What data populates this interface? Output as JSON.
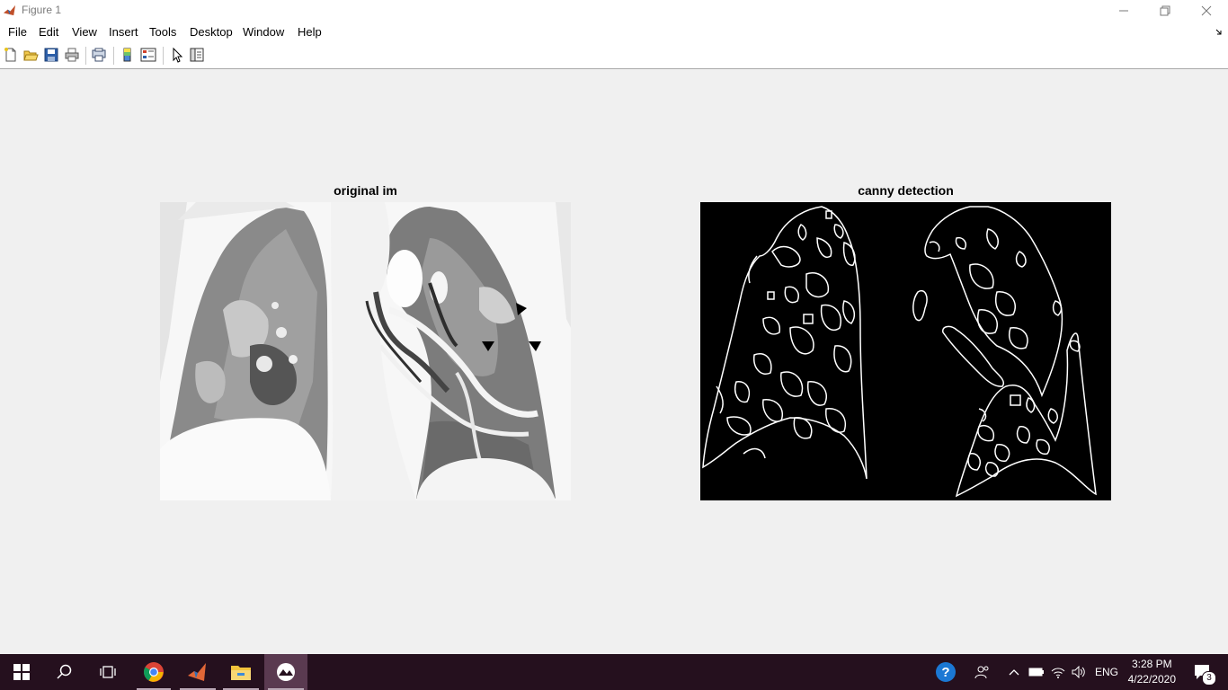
{
  "window": {
    "title": "Figure 1"
  },
  "menu": {
    "items": [
      "File",
      "Edit",
      "View",
      "Insert",
      "Tools",
      "Desktop",
      "Window",
      "Help"
    ]
  },
  "toolbar": {
    "buttons": [
      "new-figure-icon",
      "open-file-icon",
      "save-icon",
      "print-icon",
      "print-preview-icon",
      "insert-colorbar-icon",
      "insert-legend-icon",
      "edit-plot-icon",
      "property-inspector-icon"
    ]
  },
  "figure": {
    "left_axes": {
      "title": "original im"
    },
    "right_axes": {
      "title": "canny detection"
    }
  },
  "taskbar": {
    "apps": [
      "start-icon",
      "search-icon",
      "task-view-icon",
      "chrome-icon",
      "matlab-icon",
      "file-explorer-icon",
      "figure-app-icon"
    ],
    "tray": {
      "language": "ENG",
      "notification_count": "3"
    },
    "clock": {
      "time": "3:28 PM",
      "date": "4/22/2020"
    }
  },
  "colors": {
    "taskbar": "#25101e",
    "figure_bg": "#f0f0f0",
    "axes_dark": "#000000"
  }
}
